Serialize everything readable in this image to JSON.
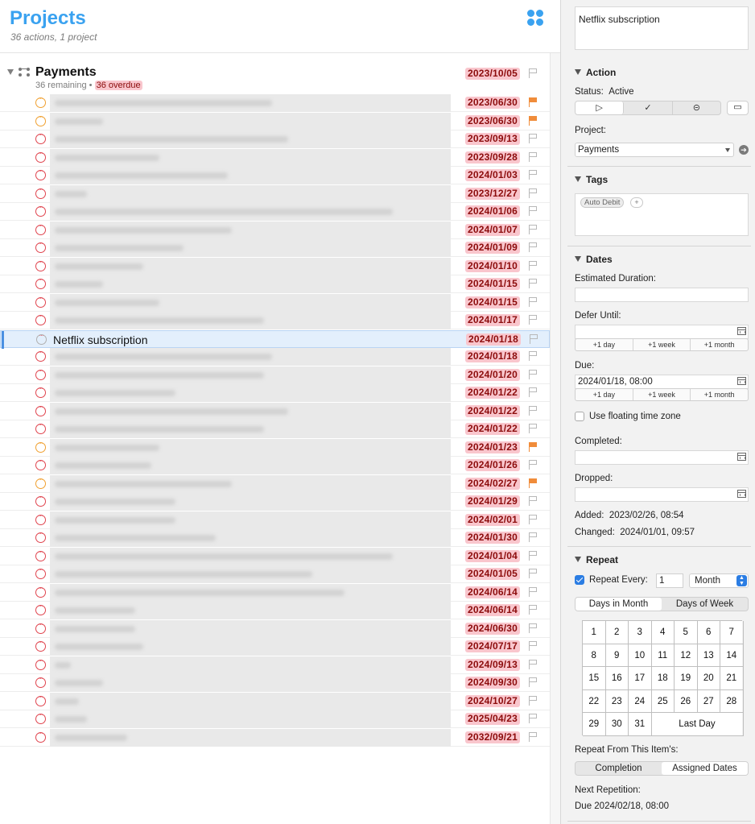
{
  "header": {
    "title": "Projects",
    "subtitle": "36 actions, 1 project"
  },
  "project": {
    "name": "Payments",
    "remaining": "36 remaining",
    "separator": "•",
    "overdue": "36 overdue",
    "date": "2023/10/05"
  },
  "rows": [
    {
      "date": "2023/06/30",
      "flag": true,
      "status": "orange",
      "w": 270
    },
    {
      "date": "2023/06/30",
      "flag": true,
      "status": "orange",
      "w": 60
    },
    {
      "date": "2023/09/13",
      "flag": false,
      "status": "red",
      "w": 290
    },
    {
      "date": "2023/09/28",
      "flag": false,
      "status": "red",
      "w": 130
    },
    {
      "date": "2024/01/03",
      "flag": false,
      "status": "red",
      "w": 215
    },
    {
      "date": "2023/12/27",
      "flag": false,
      "status": "red",
      "w": 40
    },
    {
      "date": "2024/01/06",
      "flag": false,
      "status": "red",
      "w": 420
    },
    {
      "date": "2024/01/07",
      "flag": false,
      "status": "red",
      "w": 220
    },
    {
      "date": "2024/01/09",
      "flag": false,
      "status": "red",
      "w": 160
    },
    {
      "date": "2024/01/10",
      "flag": false,
      "status": "red",
      "w": 110
    },
    {
      "date": "2024/01/15",
      "flag": false,
      "status": "red",
      "w": 60
    },
    {
      "date": "2024/01/15",
      "flag": false,
      "status": "red",
      "w": 130
    },
    {
      "date": "2024/01/17",
      "flag": false,
      "status": "red",
      "w": 260
    },
    {
      "date": "2024/01/18",
      "flag": false,
      "status": "grey",
      "title": "Netflix subscription",
      "selected": true
    },
    {
      "date": "2024/01/18",
      "flag": false,
      "status": "red",
      "w": 270
    },
    {
      "date": "2024/01/20",
      "flag": false,
      "status": "red",
      "w": 260
    },
    {
      "date": "2024/01/22",
      "flag": false,
      "status": "red",
      "w": 150
    },
    {
      "date": "2024/01/22",
      "flag": false,
      "status": "red",
      "w": 290
    },
    {
      "date": "2024/01/22",
      "flag": false,
      "status": "red",
      "w": 260
    },
    {
      "date": "2024/01/23",
      "flag": true,
      "status": "orange",
      "w": 130
    },
    {
      "date": "2024/01/26",
      "flag": false,
      "status": "red",
      "w": 120
    },
    {
      "date": "2024/02/27",
      "flag": true,
      "status": "orange",
      "w": 220
    },
    {
      "date": "2024/01/29",
      "flag": false,
      "status": "red",
      "w": 150
    },
    {
      "date": "2024/02/01",
      "flag": false,
      "status": "red",
      "w": 150
    },
    {
      "date": "2024/01/30",
      "flag": false,
      "status": "red",
      "w": 200
    },
    {
      "date": "2024/01/04",
      "flag": false,
      "status": "red",
      "w": 420
    },
    {
      "date": "2024/01/05",
      "flag": false,
      "status": "red",
      "w": 320
    },
    {
      "date": "2024/06/14",
      "flag": false,
      "status": "red",
      "w": 360
    },
    {
      "date": "2024/06/14",
      "flag": false,
      "status": "red",
      "w": 100
    },
    {
      "date": "2024/06/30",
      "flag": false,
      "status": "red",
      "w": 100
    },
    {
      "date": "2024/07/17",
      "flag": false,
      "status": "red",
      "w": 110
    },
    {
      "date": "2024/09/13",
      "flag": false,
      "status": "red",
      "w": 20
    },
    {
      "date": "2024/09/30",
      "flag": false,
      "status": "red",
      "w": 60
    },
    {
      "date": "2024/10/27",
      "flag": false,
      "status": "red",
      "w": 30
    },
    {
      "date": "2025/04/23",
      "flag": false,
      "status": "red",
      "w": 40
    },
    {
      "date": "2032/09/21",
      "flag": false,
      "status": "red",
      "w": 90
    }
  ],
  "inspector": {
    "title": "Netflix subscription",
    "action": {
      "header": "Action",
      "status_label": "Status:",
      "status_value": "Active",
      "active_glyph": "▷",
      "complete_glyph": "✓",
      "drop_glyph": "⊝",
      "folder_glyph": "▭",
      "project_label": "Project:",
      "project_value": "Payments",
      "go_glyph": "➔"
    },
    "tags": {
      "header": "Tags",
      "items": [
        "Auto Debit"
      ],
      "add_glyph": "+"
    },
    "dates": {
      "header": "Dates",
      "estimated_label": "Estimated Duration:",
      "defer_label": "Defer Until:",
      "due_label": "Due:",
      "due_value": "2024/01/18, 08:00",
      "plus_day": "+1 day",
      "plus_week": "+1 week",
      "plus_month": "+1 month",
      "floating_label": "Use floating time zone",
      "completed_label": "Completed:",
      "dropped_label": "Dropped:",
      "added_label": "Added:",
      "added_value": "2023/02/26, 08:54",
      "changed_label": "Changed:",
      "changed_value": "2024/01/01, 09:57"
    },
    "repeat": {
      "header": "Repeat",
      "every_label": "Repeat Every:",
      "every_value": "1",
      "unit": "Month",
      "stepper_up": "▲",
      "stepper_down": "▼",
      "mode_month": "Days in Month",
      "mode_week": "Days of Week",
      "days": [
        "1",
        "2",
        "3",
        "4",
        "5",
        "6",
        "7",
        "8",
        "9",
        "10",
        "11",
        "12",
        "13",
        "14",
        "15",
        "16",
        "17",
        "18",
        "19",
        "20",
        "21",
        "22",
        "23",
        "24",
        "25",
        "26",
        "27",
        "28",
        "29",
        "30",
        "31"
      ],
      "last_day": "Last Day",
      "from_label": "Repeat From This Item's:",
      "from_completion": "Completion",
      "from_assigned": "Assigned Dates",
      "next_label": "Next Repetition:",
      "next_value": "Due 2024/02/18, 08:00"
    }
  }
}
